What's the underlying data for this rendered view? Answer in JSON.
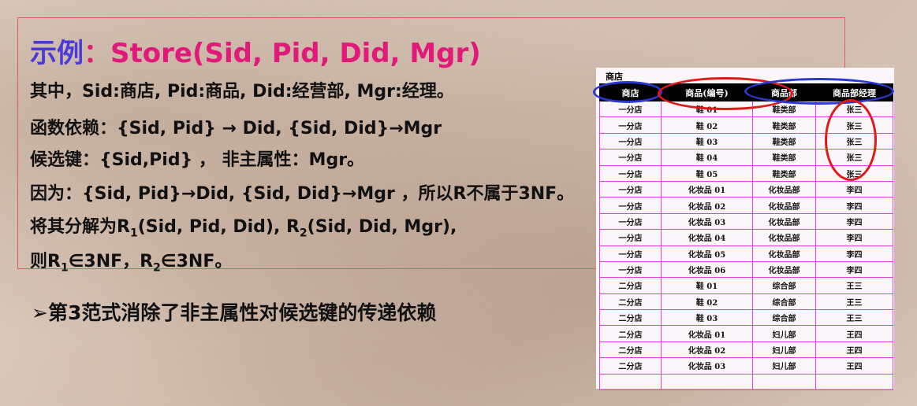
{
  "title": {
    "prefix": "示例",
    "separator": "：",
    "formula": "Store(Sid, Pid, Did, Mgr)"
  },
  "lines": {
    "where": "其中，Sid:商店, Pid:商品, Did:经营部, Mgr:经理。",
    "fd": "函数依赖：{Sid, Pid} → Did,  {Sid, Did}→Mgr",
    "candidate": "候选键：{Sid,Pid} ， 非主属性：Mgr。",
    "because": "因为：{Sid, Pid}→Did,  {Sid, Did}→Mgr ，所以R不属于3NF。",
    "decompose": {
      "a": "将其分解为R",
      "b": "(Sid, Pid, Did), R",
      "c": "(Sid, Did, Mgr),",
      "sub1": "1",
      "sub2": "2"
    },
    "conclusion": {
      "a": "则R",
      "b": "∈3NF，R",
      "c": "∈3NF。",
      "sub1": "1",
      "sub2": "2"
    }
  },
  "bullet": "➢第3范式消除了非主属性对候选键的传递依赖",
  "table": {
    "caption": "商店",
    "headers": [
      "商店",
      "商品(编号)",
      "商品部",
      "商品部经理"
    ],
    "rows": [
      [
        "一分店",
        "鞋 01",
        "鞋类部",
        "张三"
      ],
      [
        "一分店",
        "鞋 02",
        "鞋类部",
        "张三"
      ],
      [
        "一分店",
        "鞋 03",
        "鞋类部",
        "张三"
      ],
      [
        "一分店",
        "鞋 04",
        "鞋类部",
        "张三"
      ],
      [
        "一分店",
        "鞋 05",
        "鞋类部",
        "张三"
      ],
      [
        "一分店",
        "化妆品 01",
        "化妆品部",
        "李四"
      ],
      [
        "一分店",
        "化妆品 02",
        "化妆品部",
        "李四"
      ],
      [
        "一分店",
        "化妆品 03",
        "化妆品部",
        "李四"
      ],
      [
        "一分店",
        "化妆品 04",
        "化妆品部",
        "李四"
      ],
      [
        "一分店",
        "化妆品 05",
        "化妆品部",
        "李四"
      ],
      [
        "一分店",
        "化妆品 06",
        "化妆品部",
        "李四"
      ],
      [
        "二分店",
        "鞋 01",
        "综合部",
        "王三"
      ],
      [
        "二分店",
        "鞋 02",
        "综合部",
        "王三"
      ],
      [
        "二分店",
        "鞋 03",
        "综合部",
        "王三"
      ],
      [
        "二分店",
        "化妆品 01",
        "妇儿部",
        "王四"
      ],
      [
        "二分店",
        "化妆品 02",
        "妇儿部",
        "王四"
      ],
      [
        "二分店",
        "化妆品 03",
        "妇儿部",
        "王四"
      ],
      [
        "",
        "",
        "",
        ""
      ]
    ]
  },
  "colors": {
    "title_prefix": "#4a3bd9",
    "title_formula": "#e0197a",
    "frame": "#e05a6a",
    "table_grid": "#e040e0",
    "oval_blue": "#2a3ad0",
    "oval_red": "#e01818"
  }
}
